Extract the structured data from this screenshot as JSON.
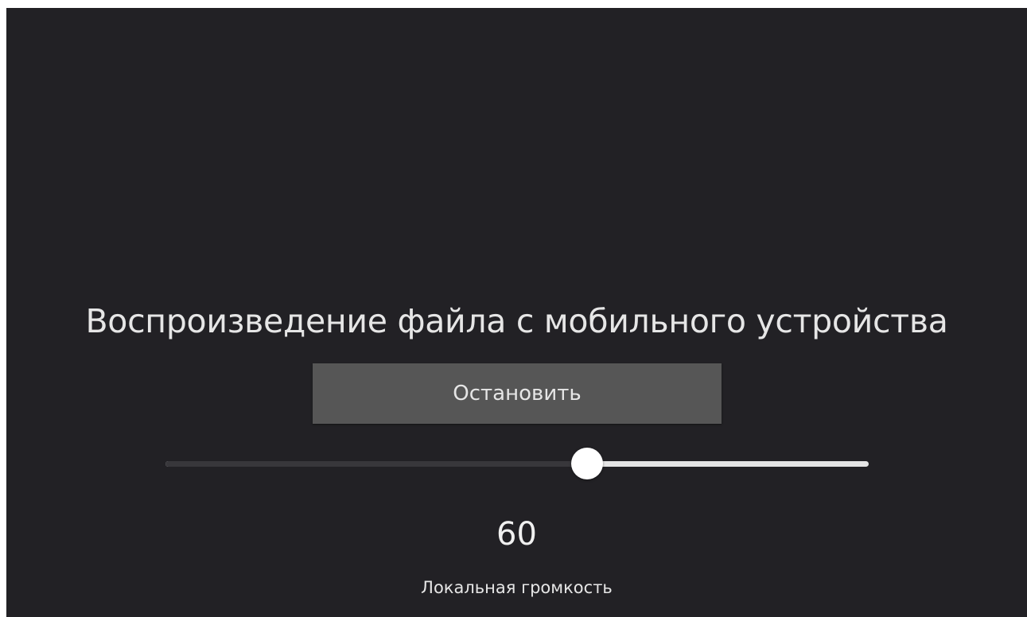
{
  "player": {
    "title": "Воспроизведение файла с мобильного устройства",
    "stop_label": "Остановить"
  },
  "volume": {
    "value": 60,
    "value_text": "60",
    "min": 0,
    "max": 100,
    "label": "Локальная громкость"
  },
  "colors": {
    "background": "#222125",
    "button": "#565656",
    "text": "#e6e6e6",
    "track_filled": "#38373b",
    "track_empty": "#e4e4e4",
    "thumb": "#ffffff"
  }
}
